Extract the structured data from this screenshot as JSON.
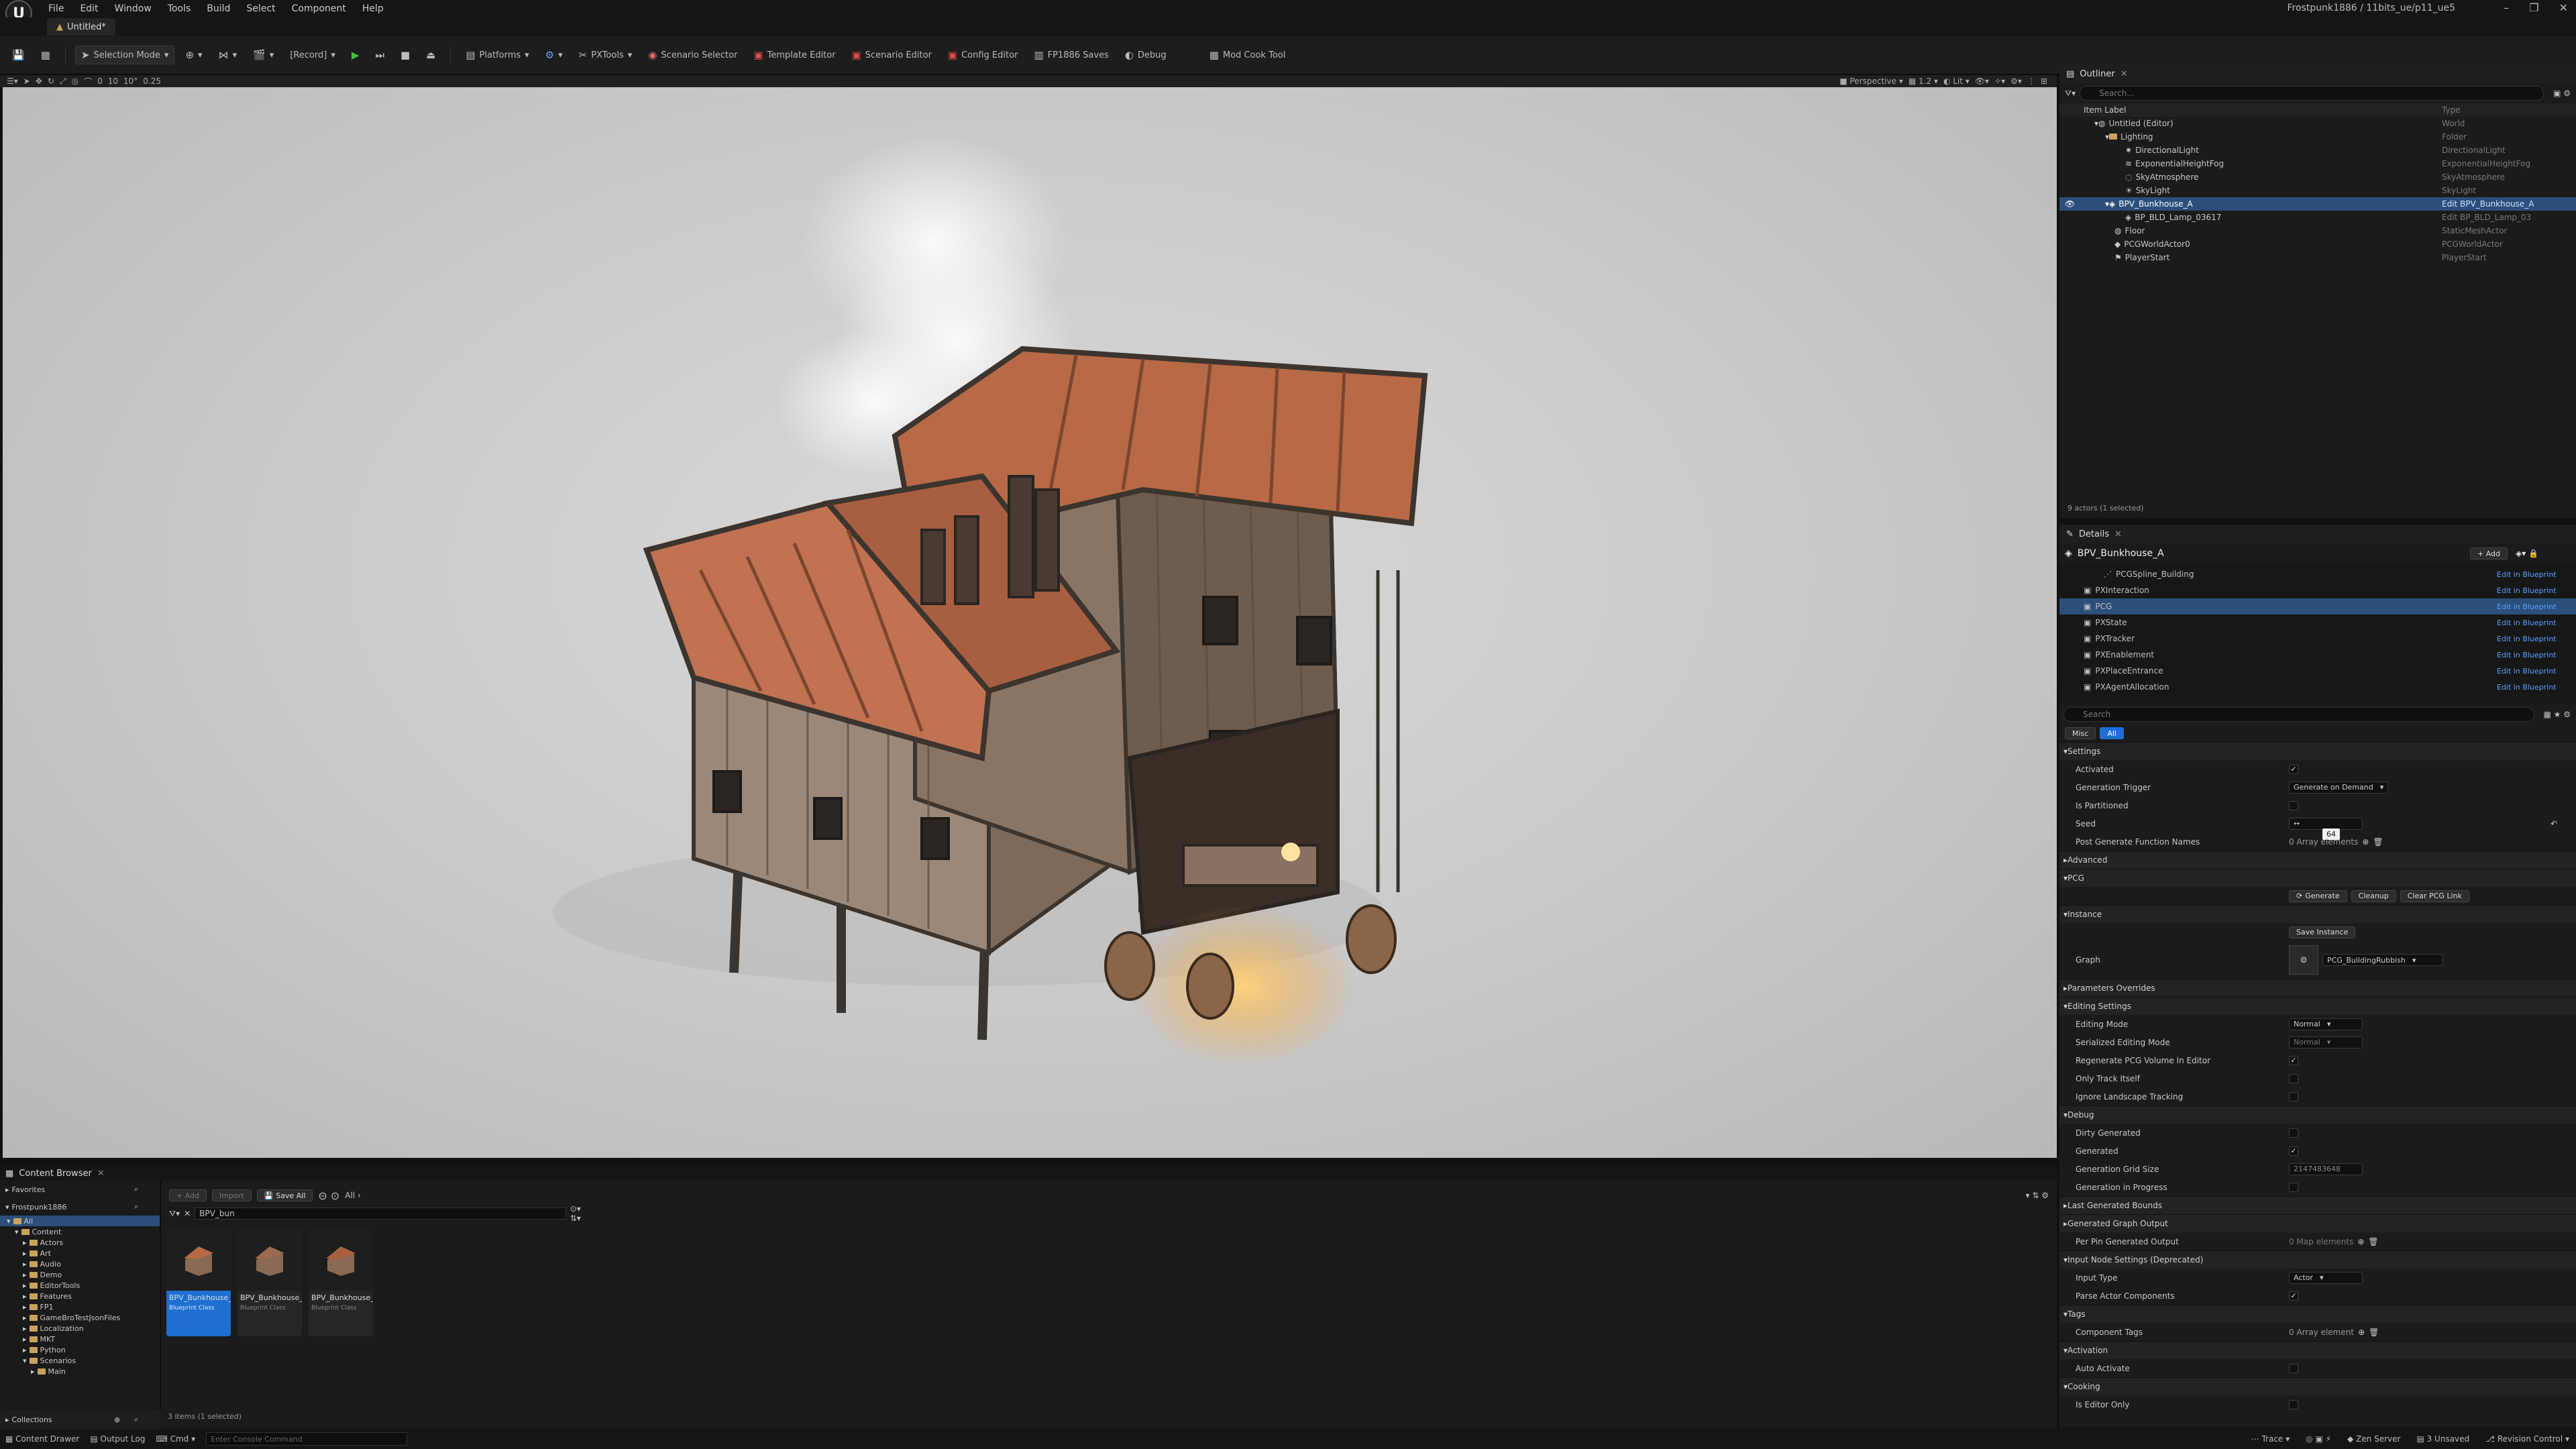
{
  "app": {
    "window_title": "Frostpunk1886 / 11bits_ue/p11_ue5",
    "menu": [
      "File",
      "Edit",
      "Window",
      "Tools",
      "Build",
      "Select",
      "Component",
      "Help"
    ],
    "doc_tab": "Untitled*"
  },
  "toolbar": {
    "mode": "Selection Mode",
    "record": "[Record]",
    "items": [
      "Platforms",
      "PXTools",
      "Scenario Selector",
      "Template Editor",
      "Scenario Editor",
      "Config Editor",
      "FP1886 Saves",
      "Debug",
      "Mod Cook Tool"
    ]
  },
  "viewport_toolbar": {
    "snap_values": [
      "0",
      "10",
      "10°",
      "0.25"
    ],
    "view": "Perspective",
    "lit": "Lit",
    "speed": "1.2"
  },
  "outliner": {
    "title": "Outliner",
    "search_placeholder": "Search...",
    "col_label": "Item Label",
    "col_type": "Type",
    "rows": [
      {
        "label": "Untitled (Editor)",
        "type": "World"
      },
      {
        "label": "Lighting",
        "type": "Folder"
      },
      {
        "label": "DirectionalLight",
        "type": "DirectionalLight"
      },
      {
        "label": "ExponentialHeightFog",
        "type": "ExponentialHeightFog"
      },
      {
        "label": "SkyAtmosphere",
        "type": "SkyAtmosphere"
      },
      {
        "label": "SkyLight",
        "type": "SkyLight"
      },
      {
        "label": "BPV_Bunkhouse_A",
        "type": "Edit BPV_Bunkhouse_A"
      },
      {
        "label": "BP_BLD_Lamp_03617",
        "type": "Edit BP_BLD_Lamp_03"
      },
      {
        "label": "Floor",
        "type": "StaticMeshActor"
      },
      {
        "label": "PCGWorldActor0",
        "type": "PCGWorldActor"
      },
      {
        "label": "PlayerStart",
        "type": "PlayerStart"
      }
    ],
    "footer": "9 actors (1 selected)"
  },
  "details": {
    "title": "Details",
    "actor": "BPV_Bunkhouse_A",
    "add_label": "+ Add",
    "components": [
      {
        "name": "PCGSpline_Building",
        "link": "Edit in Blueprint"
      },
      {
        "name": "PXInteraction",
        "link": "Edit in Blueprint"
      },
      {
        "name": "PCG",
        "link": "Edit in Blueprint"
      },
      {
        "name": "PXState",
        "link": "Edit in Blueprint"
      },
      {
        "name": "PXTracker",
        "link": "Edit in Blueprint"
      },
      {
        "name": "PXEnablement",
        "link": "Edit in Blueprint"
      },
      {
        "name": "PXPlaceEntrance",
        "link": "Edit in Blueprint"
      },
      {
        "name": "PXAgentAllocation",
        "link": "Edit in Blueprint"
      }
    ],
    "search_placeholder": "Search",
    "filter_tabs": [
      "Misc",
      "All"
    ],
    "sections": {
      "settings": "Settings",
      "advanced": "Advanced",
      "pcg": "PCG",
      "instance": "Instance",
      "param_overrides": "Parameters Overrides",
      "editing": "Editing Settings",
      "debug": "Debug",
      "last_bounds": "Last Generated Bounds",
      "graph_output": "Generated Graph Output",
      "input_node": "Input Node Settings (Deprecated)",
      "tags": "Tags",
      "activation": "Activation",
      "cooking": "Cooking"
    },
    "labels": {
      "activated": "Activated",
      "gen_trigger": "Generation Trigger",
      "partitioned": "Is Partitioned",
      "seed": "Seed",
      "post_gen": "Post Generate Function Names",
      "graph": "Graph",
      "editing_mode": "Editing Mode",
      "serialized_mode": "Serialized Editing Mode",
      "regen_volume": "Regenerate PCG Volume In Editor",
      "track_self": "Only Track Itself",
      "ignore_landscape": "Ignore Landscape Tracking",
      "dirty": "Dirty Generated",
      "generated": "Generated",
      "grid_size": "Generation Grid Size",
      "in_progress": "Generation in Progress",
      "per_pin": "Per Pin Generated Output",
      "input_type": "Input Type",
      "parse_actor": "Parse Actor Components",
      "comp_tags": "Component Tags",
      "auto_activate": "Auto Activate",
      "editor_only": "Is Editor Only"
    },
    "values": {
      "gen_trigger": "Generate on Demand",
      "seed_tooltip": "64",
      "post_gen": "0 Array elements",
      "graph_name": "PCG_BuildingRubbish",
      "editing_mode": "Normal",
      "serialized_mode": "Normal",
      "grid_size": "2147483648",
      "per_pin": "0 Map elements",
      "input_type": "Actor",
      "comp_tags": "0 Array element"
    },
    "buttons": {
      "generate": "Generate",
      "cleanup": "Cleanup",
      "clear_link": "Clear PCG Link",
      "save_instance": "Save Instance"
    }
  },
  "content_browser": {
    "tab": "Content Browser",
    "add": "+ Add",
    "import": "Import",
    "save_all": "Save All",
    "path_root": "All",
    "favorites": "Favorites",
    "project": "Frostpunk1886",
    "tree": [
      "All",
      "Content",
      "Actors",
      "Art",
      "Audio",
      "Demo",
      "EditorTools",
      "Features",
      "FP1",
      "GameBroTestJsonFiles",
      "Localization",
      "MKT",
      "Python",
      "Scenarios",
      "Main"
    ],
    "filter_text": "BPV_bun",
    "assets": [
      {
        "name": "BPV_Bunkhouse_A",
        "cls": "Blueprint Class"
      },
      {
        "name": "BPV_Bunkhouse_B",
        "cls": "Blueprint Class"
      },
      {
        "name": "BPV_Bunkhouse_C",
        "cls": "Blueprint Class"
      }
    ],
    "count": "3 items (1 selected)",
    "collections": "Collections"
  },
  "statusbar": {
    "content_drawer": "Content Drawer",
    "output_log": "Output Log",
    "cmd": "Cmd",
    "cmd_placeholder": "Enter Console Command",
    "trace": "Trace",
    "zen": "Zen Server",
    "unsaved": "3 Unsaved",
    "revision": "Revision Control"
  },
  "colors": {
    "accent": "#2b4f7a",
    "link": "#5aa0ff",
    "play": "#3fbf3f",
    "selection": "#1e6fd0"
  }
}
